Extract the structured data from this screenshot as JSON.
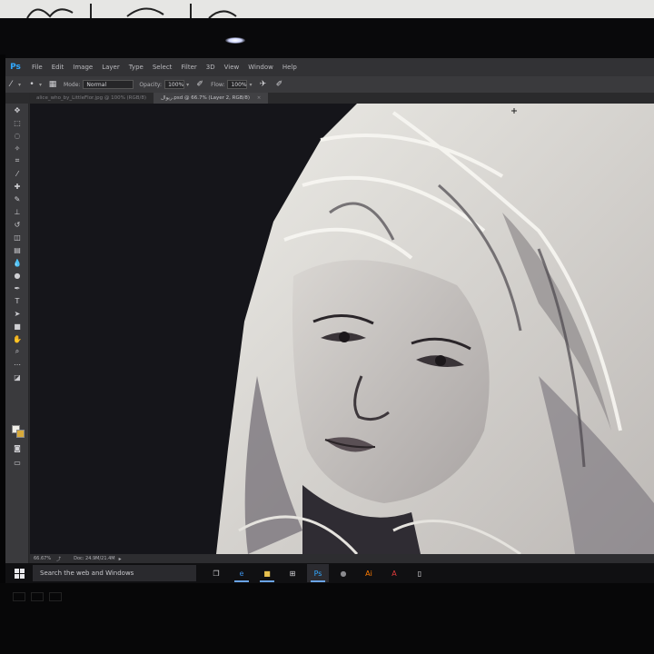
{
  "app": {
    "logo": "Ps",
    "menu": [
      "File",
      "Edit",
      "Image",
      "Layer",
      "Type",
      "Select",
      "Filter",
      "3D",
      "View",
      "Window",
      "Help"
    ]
  },
  "options": {
    "mode_label": "Mode:",
    "mode_value": "Normal",
    "opacity_label": "Opacity:",
    "opacity_value": "100%",
    "flow_label": "Flow:",
    "flow_value": "100%"
  },
  "tabs": [
    {
      "label": "alice_who_by_LittleFlor.jpg @ 100% (RGB/8)",
      "active": false
    },
    {
      "label": "ريوال.psd @ 66.7% (Layer 2, RGB/8)",
      "active": true
    }
  ],
  "statusbar": {
    "zoom": "66.67%",
    "doc": "Doc: 24.9M/21.4M"
  },
  "taskbar": {
    "search_placeholder": "Search the web and Windows",
    "icons": [
      {
        "name": "task-view-icon",
        "glyph": "❐",
        "color": "#d8d8dc"
      },
      {
        "name": "edge-browser-icon",
        "glyph": "e",
        "color": "#3c8fe6"
      },
      {
        "name": "file-explorer-icon",
        "glyph": "■",
        "color": "#e7c04e"
      },
      {
        "name": "store-icon",
        "glyph": "⊞",
        "color": "#d8d8dc"
      },
      {
        "name": "photoshop-icon",
        "glyph": "Ps",
        "color": "#31a8ff"
      },
      {
        "name": "steam-icon",
        "glyph": "●",
        "color": "#8a8a8e"
      },
      {
        "name": "illustrator-icon",
        "glyph": "Ai",
        "color": "#ff7c00"
      },
      {
        "name": "acrobat-icon",
        "glyph": "A",
        "color": "#e23c3c"
      },
      {
        "name": "document-icon",
        "glyph": "▯",
        "color": "#e8e8ec"
      }
    ]
  },
  "colors": {
    "foreground_swatch": "#f1efe8",
    "background_swatch": "#d7a93a",
    "accent": "#31a8ff"
  }
}
